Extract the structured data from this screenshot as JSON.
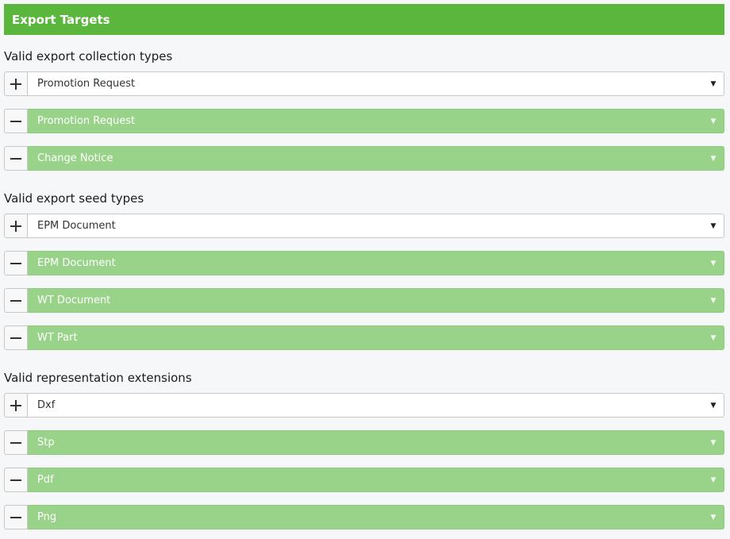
{
  "header": {
    "title": "Export Targets"
  },
  "sections": [
    {
      "title": "Valid export collection types",
      "add_value": "Promotion Request",
      "entries": [
        "Promotion Request",
        "Change Notice"
      ]
    },
    {
      "title": "Valid export seed types",
      "add_value": "EPM Document",
      "entries": [
        "EPM Document",
        "WT Document",
        "WT Part"
      ]
    },
    {
      "title": "Valid representation extensions",
      "add_value": "Dxf",
      "entries": [
        "Stp",
        "Pdf",
        "Png"
      ]
    }
  ],
  "icons": {
    "add": "plus-icon",
    "remove": "minus-icon",
    "dropdown": "caret-down-icon"
  },
  "colors": {
    "header": "#5bb63e",
    "entry": "#99d289"
  }
}
